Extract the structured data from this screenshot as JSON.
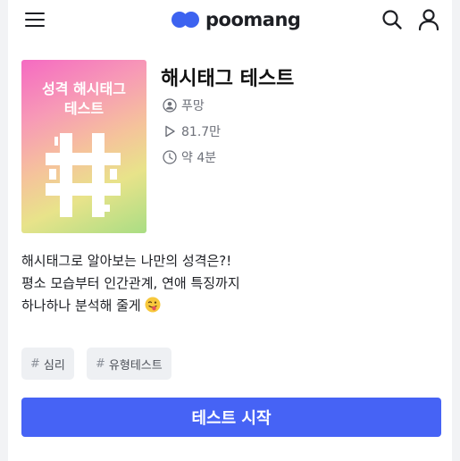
{
  "header": {
    "logo_text": "poomang",
    "brand_color": "#3d63f0",
    "icons": [
      "hamburger-menu-icon",
      "search-icon",
      "user-icon"
    ]
  },
  "test": {
    "thumbnail_title_line1": "성격 해시태그",
    "thumbnail_title_line2": "테스트",
    "title": "해시태그 테스트",
    "author": "푸망",
    "views": "81.7만",
    "duration": "약 4분",
    "description_lines": [
      "해시태그로 알아보는 나만의 성격은?!",
      "평소 모습부터 인간관계, 연애 특징까지",
      "하나하나 분석해 줄게"
    ],
    "tags": [
      {
        "hash": "#",
        "label": "심리"
      },
      {
        "hash": "#",
        "label": "유형테스트"
      }
    ],
    "start_button": "테스트 시작",
    "button_color": "#4663f5"
  }
}
